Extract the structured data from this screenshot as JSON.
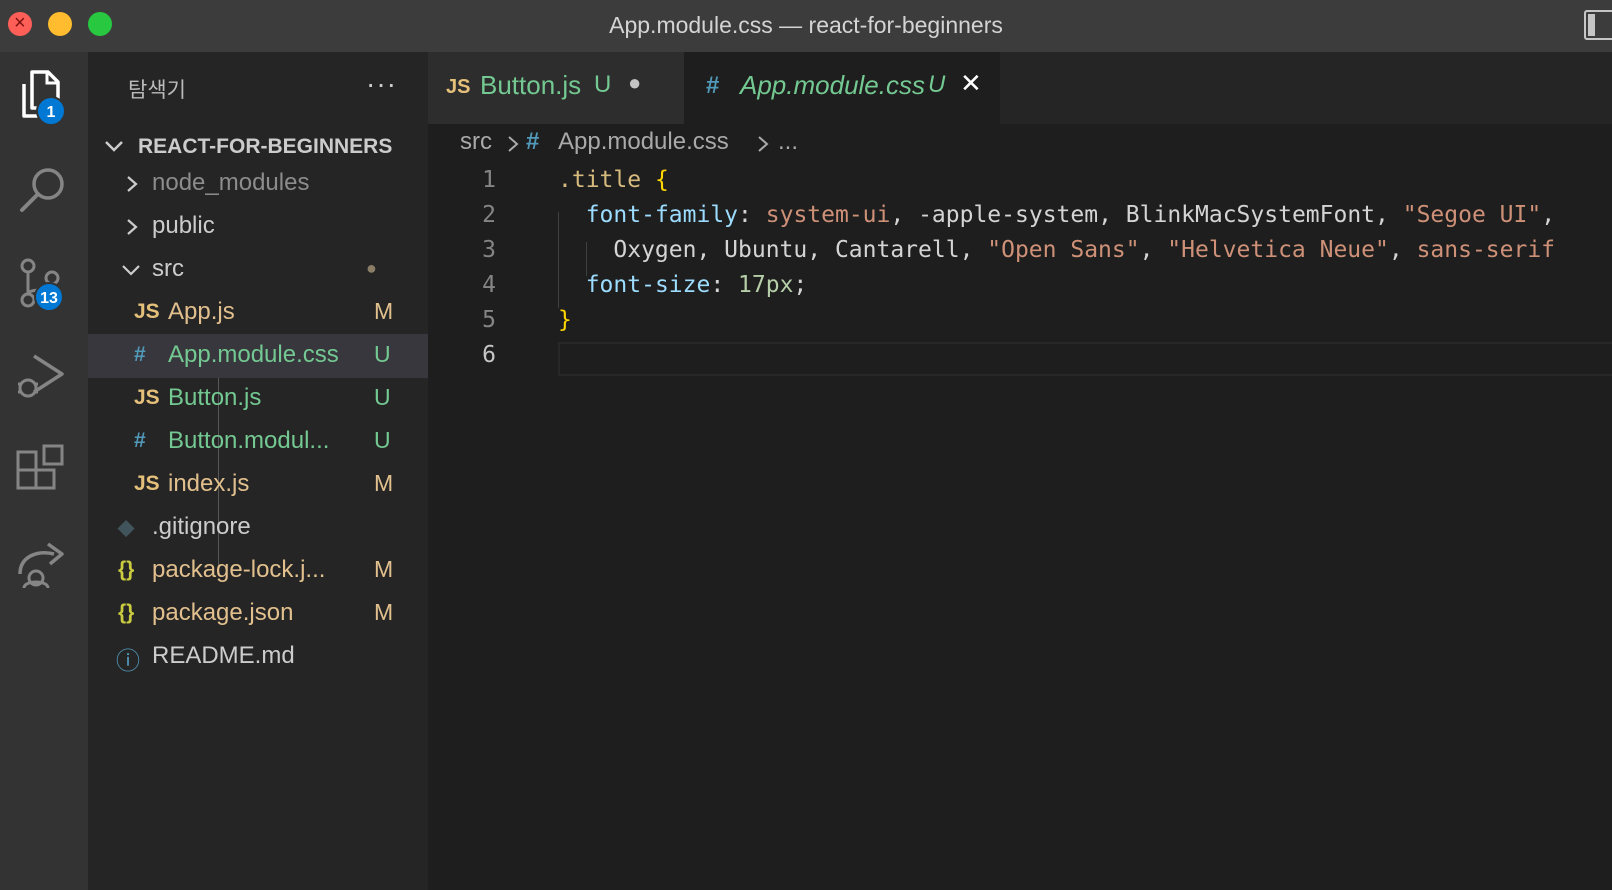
{
  "window": {
    "title": "App.module.css — react-for-beginners"
  },
  "activity_bar": {
    "explorer_badge": "1",
    "scm_badge": "13"
  },
  "explorer": {
    "title": "탐색기",
    "more_label": "···",
    "project": "REACT-FOR-BEGINNERS",
    "items": [
      {
        "icon": "",
        "name": "node_modules",
        "status": ""
      },
      {
        "icon": "",
        "name": "public",
        "status": ""
      },
      {
        "icon": "",
        "name": "src",
        "status": "●"
      },
      {
        "icon": "JS",
        "name": "App.js",
        "status": "M"
      },
      {
        "icon": "#",
        "name": "App.module.css",
        "status": "U"
      },
      {
        "icon": "JS",
        "name": "Button.js",
        "status": "U"
      },
      {
        "icon": "#",
        "name": "Button.modul...",
        "status": "U"
      },
      {
        "icon": "JS",
        "name": "index.js",
        "status": "M"
      },
      {
        "icon": "◆",
        "name": ".gitignore",
        "status": ""
      },
      {
        "icon": "{}",
        "name": "package-lock.j...",
        "status": "M"
      },
      {
        "icon": "{}",
        "name": "package.json",
        "status": "M"
      },
      {
        "icon": "ⓘ",
        "name": "README.md",
        "status": ""
      }
    ]
  },
  "tabs": [
    {
      "icon": "JS",
      "name": "Button.js",
      "status": "U",
      "indicator": "●"
    },
    {
      "icon": "#",
      "name": "App.module.css",
      "status": "U",
      "indicator": "✕"
    }
  ],
  "breadcrumb": {
    "folder": "src",
    "icon": "#",
    "file": "App.module.css",
    "more": "..."
  },
  "code": {
    "line_numbers": [
      "1",
      "2",
      "3",
      "4",
      "5",
      "6"
    ],
    "l1_selector": ".title",
    "l1_brace": "{",
    "l2_prop": "font-family",
    "l2_colon": ":",
    "l2_v1": "system-ui",
    "l2_rest": ", -apple-system, BlinkMacSystemFont, ",
    "l2_v2": "\"Segoe UI\"",
    "l2_end": ",",
    "l3_a": "Oxygen, Ubuntu, Cantarell, ",
    "l3_v1": "\"Open Sans\"",
    "l3_c": ", ",
    "l3_v2": "\"Helvetica Neue\"",
    "l3_d": ", ",
    "l3_v3": "sans-serif",
    "l4_prop": "font-size",
    "l4_colon": ": ",
    "l4_num": "17px",
    "l4_semi": ";",
    "l5_brace": "}"
  }
}
